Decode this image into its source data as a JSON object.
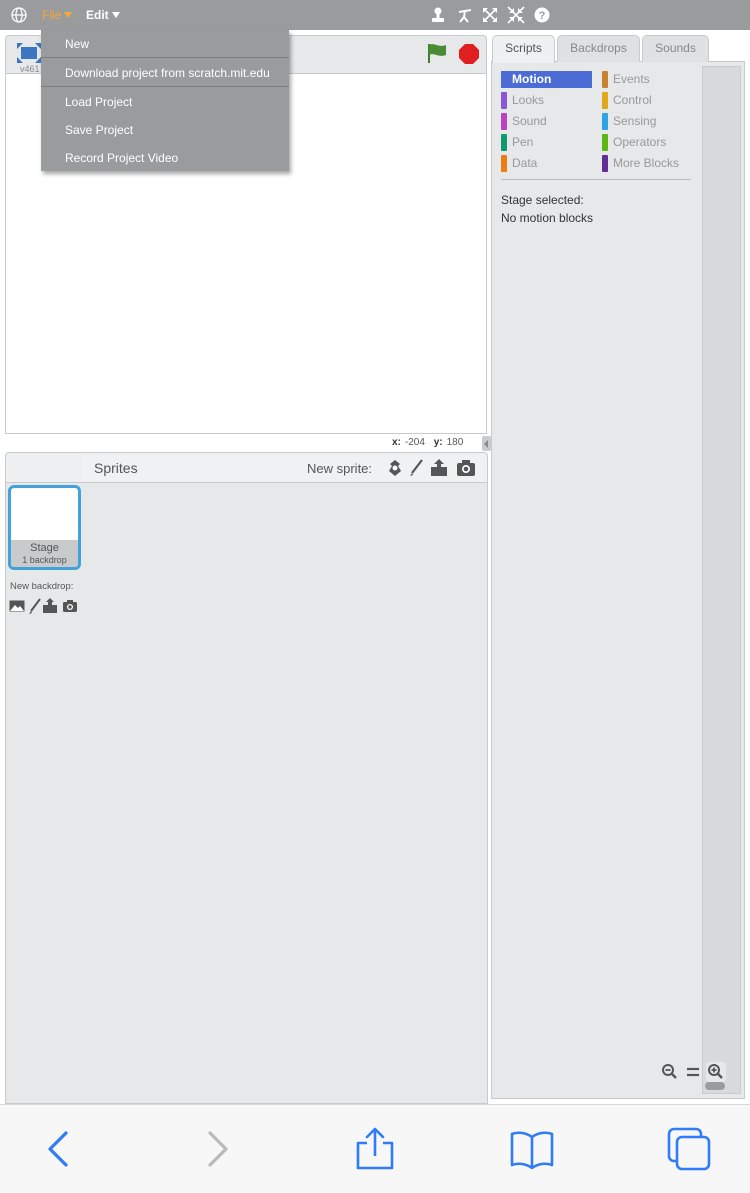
{
  "menubar": {
    "file_label": "File",
    "edit_label": "Edit",
    "tools": [
      "duplicate-icon",
      "delete-icon",
      "grow-icon",
      "shrink-icon",
      "help-icon"
    ]
  },
  "file_menu": {
    "items": [
      "New",
      "Download project from scratch.mit.edu",
      "Load Project",
      "Save Project",
      "Record Project Video"
    ]
  },
  "stage": {
    "version": "v461",
    "mouse_x_label": "x:",
    "mouse_x": "-204",
    "mouse_y_label": "y:",
    "mouse_y": "180"
  },
  "sprite_library": {
    "title": "Sprites",
    "new_sprite_label": "New sprite:",
    "stage_thumb_label": "Stage",
    "stage_thumb_sub": "1 backdrop",
    "new_backdrop_label": "New backdrop:"
  },
  "tabs": [
    "Scripts",
    "Backdrops",
    "Sounds"
  ],
  "categories": [
    {
      "label": "Motion",
      "color": "#4a6cd4",
      "active": true
    },
    {
      "label": "Looks",
      "color": "#8a55d7"
    },
    {
      "label": "Sound",
      "color": "#bb42c3"
    },
    {
      "label": "Pen",
      "color": "#0e9a6c"
    },
    {
      "label": "Data",
      "color": "#ee7d16"
    },
    {
      "label": "Events",
      "color": "#c88330"
    },
    {
      "label": "Control",
      "color": "#e1a91a"
    },
    {
      "label": "Sensing",
      "color": "#2ca5e2"
    },
    {
      "label": "Operators",
      "color": "#5cb712"
    },
    {
      "label": "More Blocks",
      "color": "#632d99"
    }
  ],
  "palette": {
    "line1": "Stage selected:",
    "line2": "No motion blocks"
  }
}
